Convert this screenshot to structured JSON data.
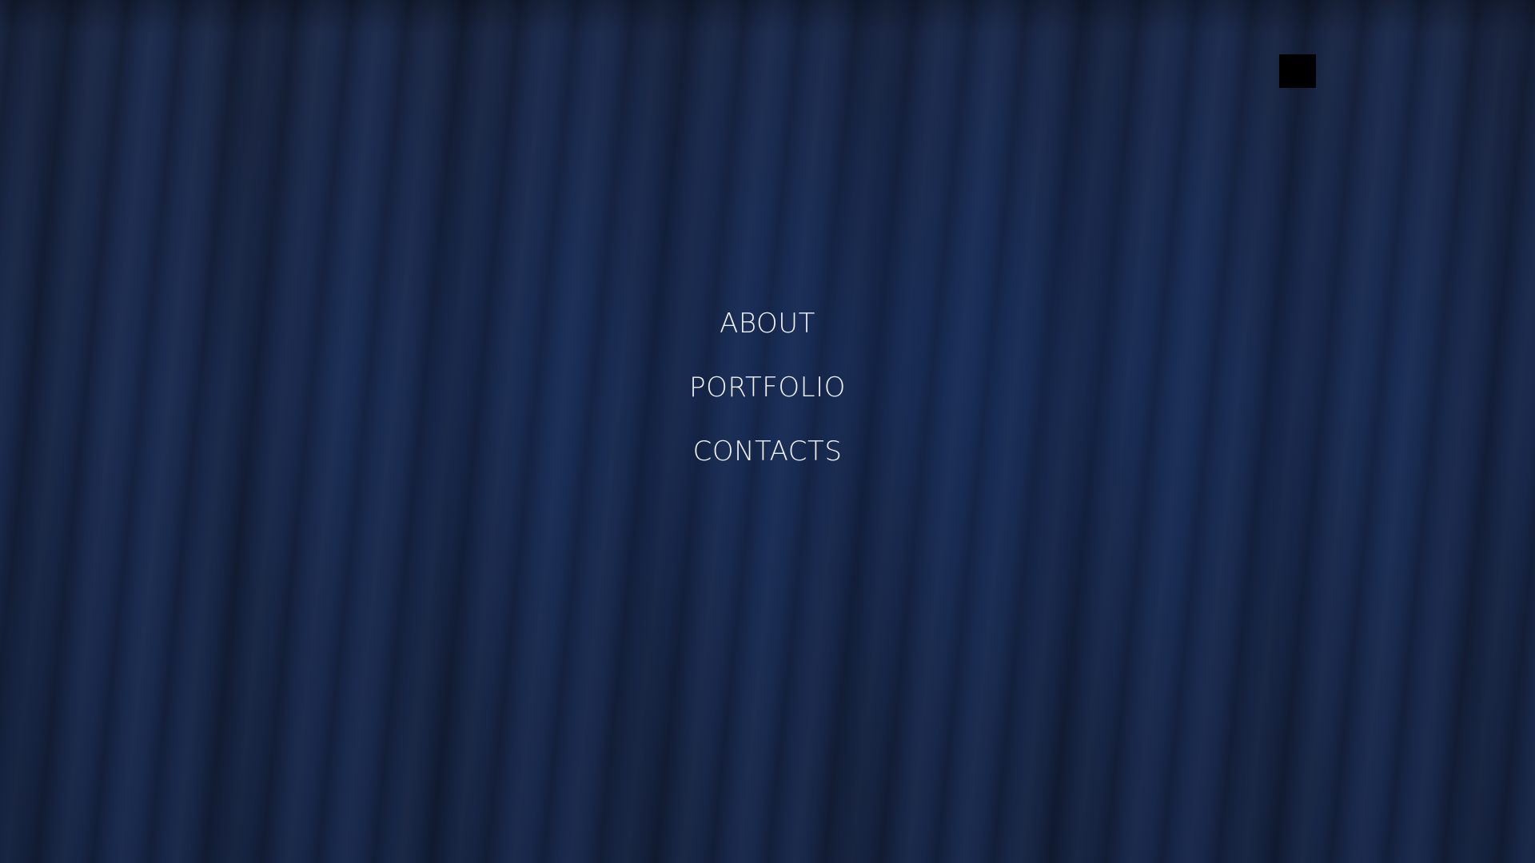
{
  "nav": {
    "items": [
      {
        "label": "ABOUT"
      },
      {
        "label": "PORTFOLIO"
      },
      {
        "label": "CONTACTS"
      }
    ]
  },
  "colors": {
    "background": "#1a2540",
    "text": "#f0f2f6",
    "toggle": "#000000"
  }
}
